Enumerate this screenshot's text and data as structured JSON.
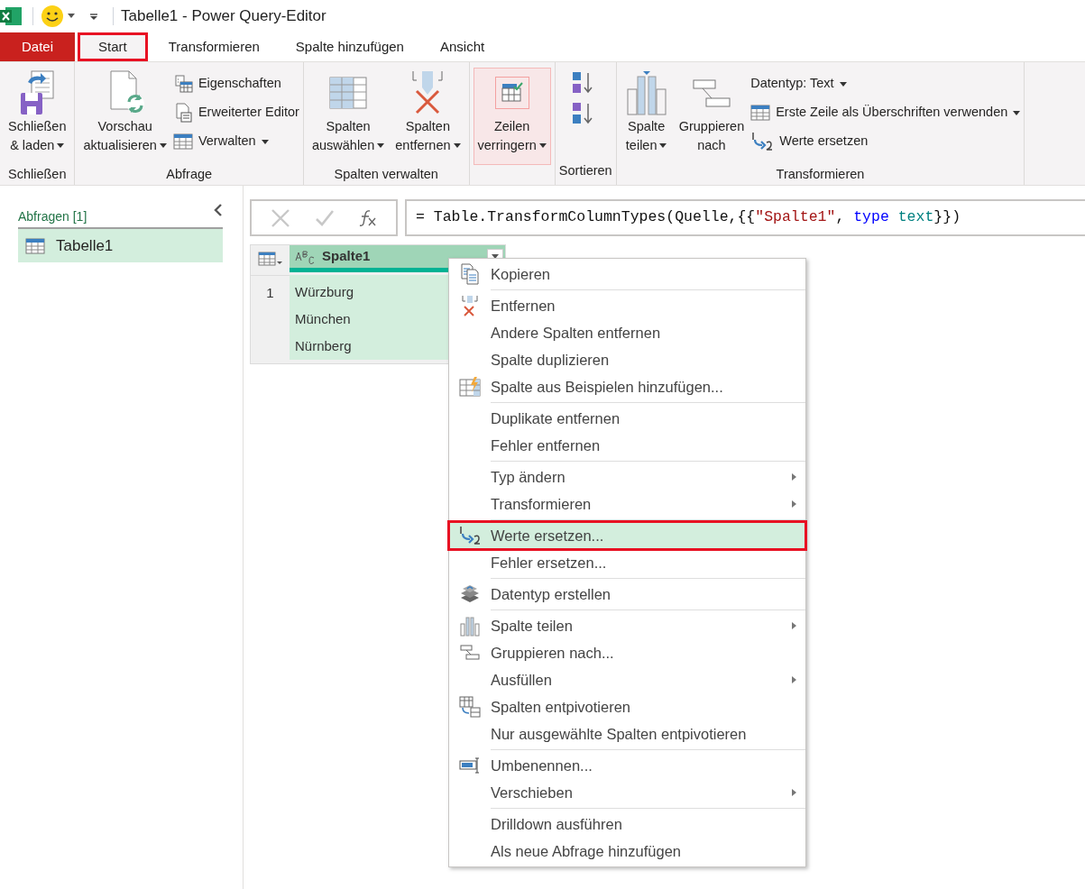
{
  "window": {
    "title": "Tabelle1 - Power Query-Editor"
  },
  "tabs": [
    {
      "label": "Datei",
      "kind": "file",
      "selected": false
    },
    {
      "label": "Start",
      "kind": "tab",
      "selected": true
    },
    {
      "label": "Transformieren",
      "kind": "tab",
      "selected": false
    },
    {
      "label": "Spalte hinzufügen",
      "kind": "tab",
      "selected": false
    },
    {
      "label": "Ansicht",
      "kind": "tab",
      "selected": false
    }
  ],
  "ribbon": [
    {
      "label": "Schließen",
      "items": [
        {
          "kind": "large",
          "lines": [
            "Schließen",
            "& laden"
          ],
          "dropdown": true,
          "highlighted": false
        }
      ]
    },
    {
      "label": "Abfrage",
      "items": [
        {
          "kind": "large",
          "lines": [
            "Vorschau",
            "aktualisieren"
          ],
          "dropdown": true,
          "highlighted": false
        },
        {
          "kind": "stack",
          "entries": [
            {
              "label": "Eigenschaften",
              "dropdown": false
            },
            {
              "label": "Erweiterter Editor",
              "dropdown": false
            },
            {
              "label": "Verwalten",
              "dropdown": true
            }
          ]
        }
      ]
    },
    {
      "label": "Spalten verwalten",
      "items": [
        {
          "kind": "large",
          "lines": [
            "Spalten",
            "auswählen"
          ],
          "dropdown": true,
          "highlighted": false
        },
        {
          "kind": "large",
          "lines": [
            "Spalten",
            "entfernen"
          ],
          "dropdown": true,
          "highlighted": false
        }
      ]
    },
    {
      "items": [
        {
          "kind": "large",
          "lines": [
            "Zeilen",
            "verringern"
          ],
          "dropdown": true,
          "highlighted": true
        }
      ]
    },
    {
      "label": "Sortieren",
      "items": [
        {
          "kind": "sort"
        }
      ]
    },
    {
      "label": "Transformieren",
      "items": [
        {
          "kind": "large",
          "lines": [
            "Spalte",
            "teilen"
          ],
          "dropdown": true,
          "highlighted": false
        },
        {
          "kind": "large",
          "lines": [
            "Gruppieren",
            "nach"
          ],
          "dropdown": false,
          "highlighted": false
        },
        {
          "kind": "stack",
          "entries": [
            {
              "label": "Datentyp: Text",
              "dropdown": true
            },
            {
              "label": "Erste Zeile als Überschriften verwenden",
              "dropdown": true
            },
            {
              "label": "Werte ersetzen",
              "dropdown": false
            }
          ]
        }
      ]
    }
  ],
  "queries": {
    "header": "Abfragen [1]",
    "items": [
      {
        "label": "Tabelle1",
        "selected": true
      }
    ]
  },
  "formula": [
    {
      "kind": "plain",
      "text": "= Table.TransformColumnTypes(Quelle,{{"
    },
    {
      "kind": "string",
      "text": "\"Spalte1\""
    },
    {
      "kind": "plain",
      "text": ", "
    },
    {
      "kind": "keyword",
      "text": "type"
    },
    {
      "kind": "type",
      "text": " text"
    },
    {
      "kind": "plain",
      "text": "}})"
    }
  ],
  "table": {
    "column": "Spalte1",
    "row_numbers": [
      "1"
    ],
    "rows": [
      "Würzburg",
      "München",
      "Nürnberg"
    ]
  },
  "menu": [
    [
      {
        "label": "Kopieren",
        "submenu": false,
        "selected": false
      }
    ],
    [
      {
        "label": "Entfernen",
        "submenu": false,
        "selected": false
      },
      {
        "label": "Andere Spalten entfernen",
        "submenu": false,
        "selected": false
      },
      {
        "label": "Spalte duplizieren",
        "submenu": false,
        "selected": false
      },
      {
        "label": "Spalte aus Beispielen hinzufügen...",
        "submenu": false,
        "selected": false
      }
    ],
    [
      {
        "label": "Duplikate entfernen",
        "submenu": false,
        "selected": false
      },
      {
        "label": "Fehler entfernen",
        "submenu": false,
        "selected": false
      }
    ],
    [
      {
        "label": "Typ ändern",
        "submenu": true,
        "selected": false
      },
      {
        "label": "Transformieren",
        "submenu": true,
        "selected": false
      }
    ],
    [
      {
        "label": "Werte ersetzen...",
        "submenu": false,
        "selected": true
      },
      {
        "label": "Fehler ersetzen...",
        "submenu": false,
        "selected": false
      }
    ],
    [
      {
        "label": "Datentyp erstellen",
        "submenu": false,
        "selected": false
      }
    ],
    [
      {
        "label": "Spalte teilen",
        "submenu": true,
        "selected": false
      },
      {
        "label": "Gruppieren nach...",
        "submenu": false,
        "selected": false
      },
      {
        "label": "Ausfüllen",
        "submenu": true,
        "selected": false
      },
      {
        "label": "Spalten entpivotieren",
        "submenu": false,
        "selected": false
      },
      {
        "label": "Nur ausgewählte Spalten entpivotieren",
        "submenu": false,
        "selected": false
      }
    ],
    [
      {
        "label": "Umbenennen...",
        "submenu": false,
        "selected": false
      },
      {
        "label": "Verschieben",
        "submenu": true,
        "selected": false
      }
    ],
    [
      {
        "label": "Drilldown ausführen",
        "submenu": false,
        "selected": false
      },
      {
        "label": "Als neue Abfrage hinzufügen",
        "submenu": false,
        "selected": false
      }
    ]
  ]
}
